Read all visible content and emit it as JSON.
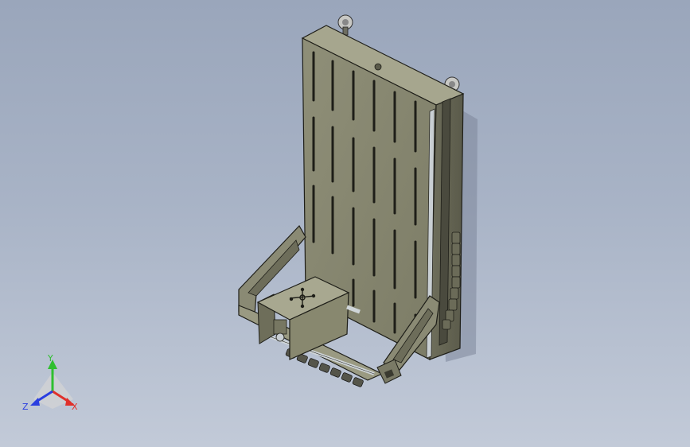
{
  "viewport": {
    "background_top": "#9aa6bb",
    "background_bottom": "#c2cad8"
  },
  "model": {
    "body_color": "#8a8a74",
    "body_dark": "#5e5e4e",
    "body_light": "#a9a990",
    "edge_color": "#1e1e18",
    "rail_color": "#c9cfd3"
  },
  "triad": {
    "x_label": "X",
    "y_label": "Y",
    "z_label": "Z",
    "x_color": "#e0302a",
    "y_color": "#2fbf2f",
    "z_color": "#2a3ee0"
  }
}
